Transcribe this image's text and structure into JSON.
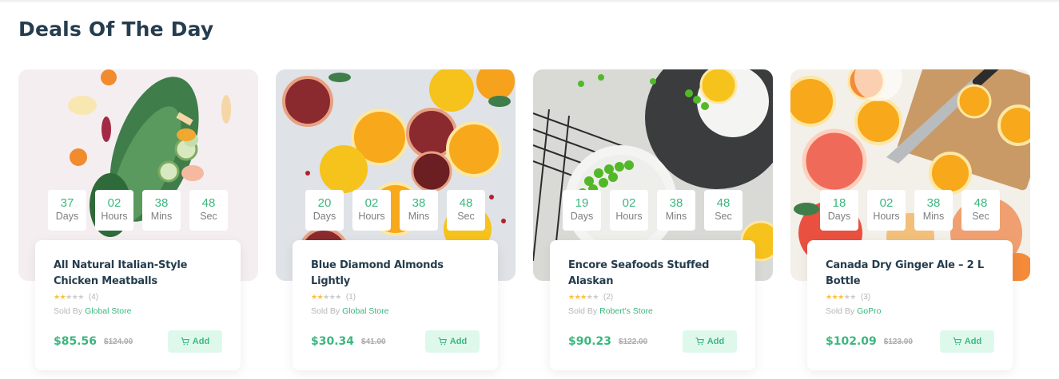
{
  "section": {
    "title": "Deals Of The Day"
  },
  "countdown_units": {
    "days": "Days",
    "hours": "Hours",
    "mins": "Mins",
    "sec": "Sec"
  },
  "labels": {
    "sold_by": "Sold By",
    "add": "Add"
  },
  "colors": {
    "brand_green": "#3bb77e",
    "button_bg": "#def9ec",
    "star": "#fdc040",
    "heading": "#253d4e"
  },
  "deals": [
    {
      "image": "vegetables-kale-icon",
      "countdown": {
        "days": "37",
        "hours": "02",
        "mins": "38",
        "sec": "48"
      },
      "name": "All Natural Italian-Style Chicken Meatballs",
      "rating_stars": 2,
      "rating_count": "(4)",
      "store": "Global Store",
      "price": "$85.56",
      "old_price": "$124.00"
    },
    {
      "image": "citrus-slices-icon",
      "countdown": {
        "days": "20",
        "hours": "02",
        "mins": "38",
        "sec": "48"
      },
      "name": "Blue Diamond Almonds Lightly",
      "rating_stars": 2,
      "rating_count": "(1)",
      "store": "Global Store",
      "price": "$30.34",
      "old_price": "$41.00"
    },
    {
      "image": "green-peas-bowl-icon",
      "countdown": {
        "days": "19",
        "hours": "02",
        "mins": "38",
        "sec": "48"
      },
      "name": "Encore Seafoods Stuffed Alaskan",
      "rating_stars": 3,
      "rating_count": "(2)",
      "store": "Robert's Store",
      "price": "$90.23",
      "old_price": "$122.00"
    },
    {
      "image": "grapefruit-knife-icon",
      "countdown": {
        "days": "18",
        "hours": "02",
        "mins": "38",
        "sec": "48"
      },
      "name": "Canada Dry Ginger Ale – 2 L Bottle",
      "rating_stars": 3,
      "rating_count": "(3)",
      "store": "GoPro",
      "price": "$102.09",
      "old_price": "$123.00"
    }
  ]
}
